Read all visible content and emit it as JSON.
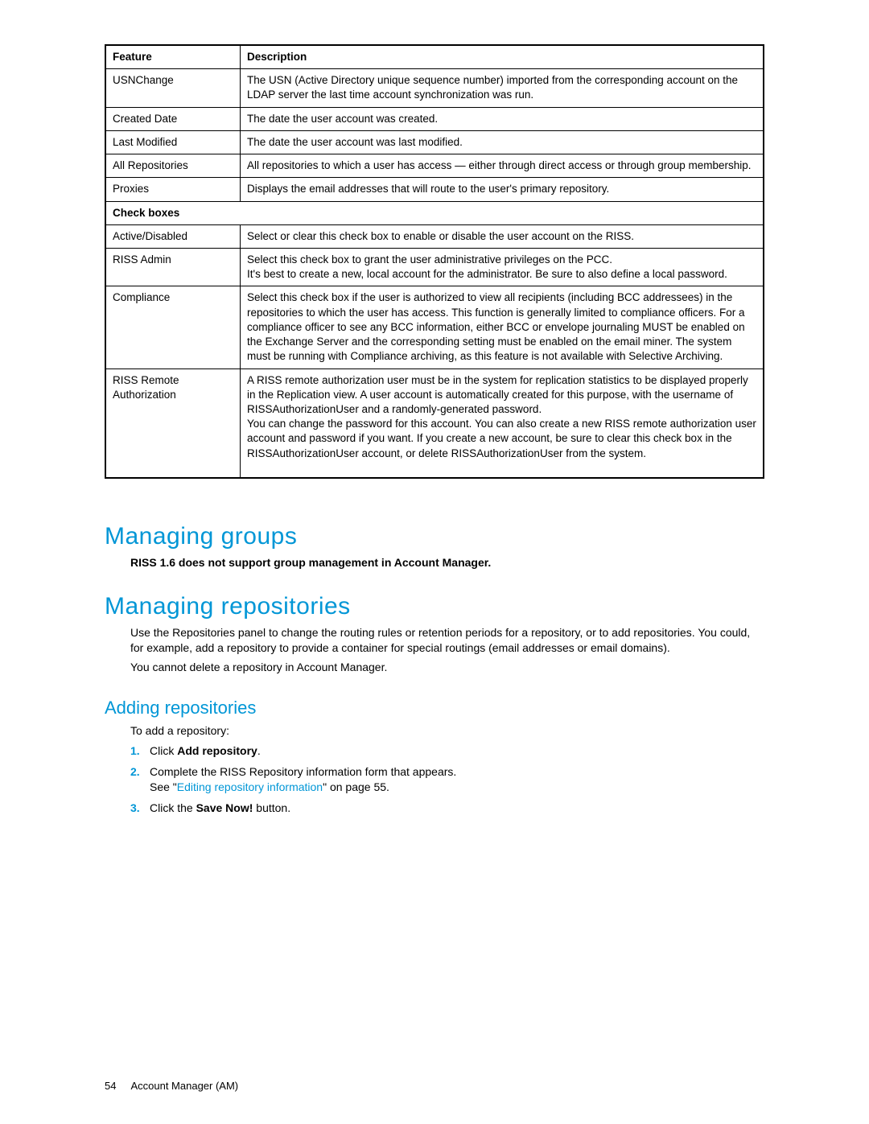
{
  "table": {
    "headers": {
      "feature": "Feature",
      "description": "Description"
    },
    "rows": [
      {
        "feature": "USNChange",
        "description": "The USN (Active Directory unique sequence number) imported from the corresponding account on the LDAP server the last time account synchronization was run."
      },
      {
        "feature": "Created Date",
        "description": "The date the user account was created."
      },
      {
        "feature": "Last Modified",
        "description": "The date the user account was last modified."
      },
      {
        "feature": "All Repositories",
        "description": "All repositories to which a user has access — either through direct access or through group membership."
      },
      {
        "feature": "Proxies",
        "description": "Displays the email addresses that will route to the user's primary repository."
      }
    ],
    "checkboxes_label": "Check boxes",
    "checkbox_rows": [
      {
        "feature": "Active/Disabled",
        "description": "Select or clear this check box to enable or disable the user account on the RISS."
      },
      {
        "feature": "RISS Admin",
        "description": "Select this check box to grant the user administrative privileges on the PCC.\nIt's best to create a new, local account for the administrator. Be sure to also define a local password."
      },
      {
        "feature": "Compliance",
        "description": "Select this check box if the user is authorized to view all recipients (including BCC addressees) in the repositories to which the user has access. This function is generally limited to compliance officers. For a compliance officer to see any BCC information, either BCC or envelope journaling MUST be enabled on the Exchange Server and the corresponding setting must be enabled on the email miner. The system must be running with Compliance archiving, as this feature is not available with Selective Archiving."
      },
      {
        "feature": "RISS Remote Authorization",
        "description": "A RISS remote authorization user must be in the system for replication statistics to be displayed properly in the Replication view. A user account is automatically created for this purpose, with the username of RISSAuthorizationUser and a randomly-generated password.\nYou can change the password for this account. You can also create a new RISS remote authorization user account and password if you want. If you create a new account, be sure to clear this check box in the RISSAuthorizationUser account, or delete RISSAuthorizationUser from the system."
      }
    ]
  },
  "sections": {
    "managing_groups": {
      "title": "Managing groups",
      "note": "RISS 1.6 does not support group management in Account Manager."
    },
    "managing_repositories": {
      "title": "Managing repositories",
      "para1": "Use the Repositories panel to change the routing rules or retention periods for a repository, or to add repositories. You could, for example, add a repository to provide a container for special routings (email addresses or email domains).",
      "para2": "You cannot delete a repository in Account Manager."
    },
    "adding_repositories": {
      "title": "Adding repositories",
      "intro": "To add a repository:",
      "step1_prefix": "Click ",
      "step1_bold": "Add repository",
      "step1_suffix": ".",
      "step2_line1": "Complete the RISS Repository information form that appears.",
      "step2_see_prefix": "See \"",
      "step2_link": "Editing repository information",
      "step2_see_suffix": "\" on page 55.",
      "step3_prefix": "Click the ",
      "step3_bold": "Save Now!",
      "step3_suffix": " button."
    }
  },
  "footer": {
    "page": "54",
    "label": "Account Manager (AM)"
  }
}
